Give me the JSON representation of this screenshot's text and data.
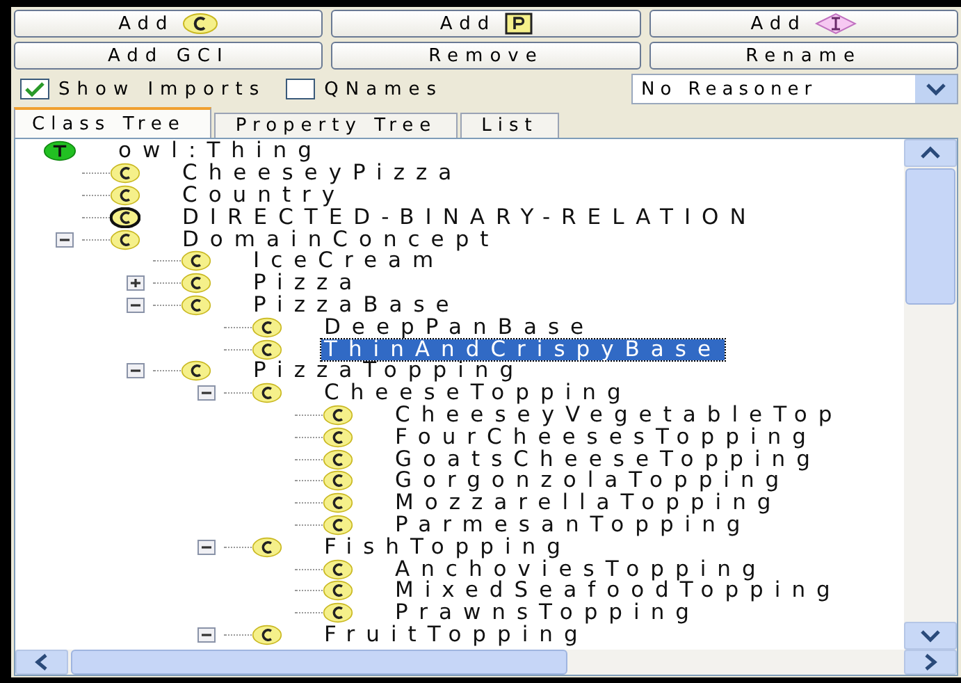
{
  "toolbar": {
    "buttons": [
      {
        "label": "Add",
        "kind": "class"
      },
      {
        "label": "Add",
        "kind": "property"
      },
      {
        "label": "Add",
        "kind": "individual"
      },
      {
        "label": "Add GCI",
        "kind": "plain"
      },
      {
        "label": "Remove",
        "kind": "plain"
      },
      {
        "label": "Rename",
        "kind": "plain"
      }
    ]
  },
  "options": {
    "checkboxes": [
      {
        "label": "Show Imports",
        "checked": true
      },
      {
        "label": "QNames",
        "checked": false
      }
    ],
    "reasoner": {
      "value": "No Reasoner"
    }
  },
  "tabs": [
    {
      "label": "Class Tree",
      "selected": true
    },
    {
      "label": "Property Tree",
      "selected": false
    },
    {
      "label": "List",
      "selected": false
    }
  ],
  "tree": [
    {
      "label": "owl:Thing",
      "kind": "thing",
      "selected": false,
      "children": [
        {
          "label": "CheeseyPizza",
          "kind": "class",
          "selected": false
        },
        {
          "label": "Country",
          "kind": "class",
          "selected": false
        },
        {
          "label": "DIRECTED-BINARY-RELATION",
          "kind": "defined",
          "selected": false
        },
        {
          "label": "DomainConcept",
          "kind": "class",
          "selected": false,
          "expanded": true,
          "children": [
            {
              "label": "IceCream",
              "kind": "class",
              "selected": false
            },
            {
              "label": "Pizza",
              "kind": "class",
              "selected": false,
              "expanded": false
            },
            {
              "label": "PizzaBase",
              "kind": "class",
              "selected": false,
              "expanded": true,
              "children": [
                {
                  "label": "DeepPanBase",
                  "kind": "class",
                  "selected": false
                },
                {
                  "label": "ThinAndCrispyBase",
                  "kind": "class",
                  "selected": true
                }
              ]
            },
            {
              "label": "PizzaTopping",
              "kind": "class",
              "selected": false,
              "expanded": true,
              "children": [
                {
                  "label": "CheeseTopping",
                  "kind": "class",
                  "selected": false,
                  "expanded": true,
                  "children": [
                    {
                      "label": "CheeseyVegetableTop",
                      "kind": "class",
                      "selected": false
                    },
                    {
                      "label": "FourCheesesTopping",
                      "kind": "class",
                      "selected": false
                    },
                    {
                      "label": "GoatsCheeseTopping",
                      "kind": "class",
                      "selected": false
                    },
                    {
                      "label": "GorgonzolaTopping",
                      "kind": "class",
                      "selected": false
                    },
                    {
                      "label": "MozzarellaTopping",
                      "kind": "class",
                      "selected": false
                    },
                    {
                      "label": "ParmesanTopping",
                      "kind": "class",
                      "selected": false
                    }
                  ]
                },
                {
                  "label": "FishTopping",
                  "kind": "class",
                  "selected": false,
                  "expanded": true,
                  "children": [
                    {
                      "label": "AnchoviesTopping",
                      "kind": "class",
                      "selected": false
                    },
                    {
                      "label": "MixedSeafoodTopping",
                      "kind": "class",
                      "selected": false
                    },
                    {
                      "label": "PrawnsTopping",
                      "kind": "class",
                      "selected": false
                    }
                  ]
                },
                {
                  "label": "FruitTopping",
                  "kind": "class",
                  "selected": false,
                  "expanded": true
                }
              ]
            }
          ]
        }
      ]
    }
  ]
}
